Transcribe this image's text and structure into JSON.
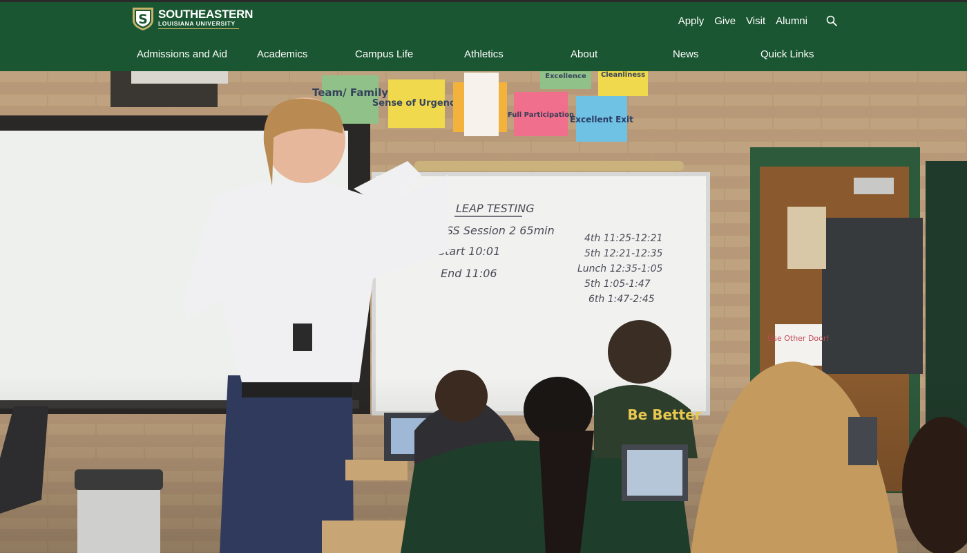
{
  "brand": {
    "shield_letter": "S",
    "name": "SOUTHEASTERN",
    "subname": "LOUISIANA UNIVERSITY",
    "primary_color": "#1a5632",
    "accent_color": "#c9b36a"
  },
  "utility_nav": [
    {
      "label": "Apply"
    },
    {
      "label": "Give"
    },
    {
      "label": "Visit"
    },
    {
      "label": "Alumni"
    }
  ],
  "search": {
    "icon": "search-icon"
  },
  "main_nav": [
    {
      "label": "Admissions and Aid"
    },
    {
      "label": "Academics"
    },
    {
      "label": "Campus Life"
    },
    {
      "label": "Athletics"
    },
    {
      "label": "About"
    },
    {
      "label": "News"
    },
    {
      "label": "Quick Links"
    }
  ],
  "hero": {
    "posters": [
      "Team/ Family",
      "Sense of Urgency",
      "Full Participation",
      "Excellent Exit",
      "Excellence",
      "Cleanliness"
    ],
    "whiteboard": [
      "LEAP TESTING",
      "SS Session 2 65min",
      "Start 10:01",
      "End 11:06",
      "4th 11:25-12:21",
      "5th 12:21-12:35",
      "Lunch 12:35-1:05",
      "5th 1:05-1:47",
      "6th 1:47-2:45"
    ],
    "door_sign": "Use Other Door!",
    "shirt_text": "Be Better"
  }
}
